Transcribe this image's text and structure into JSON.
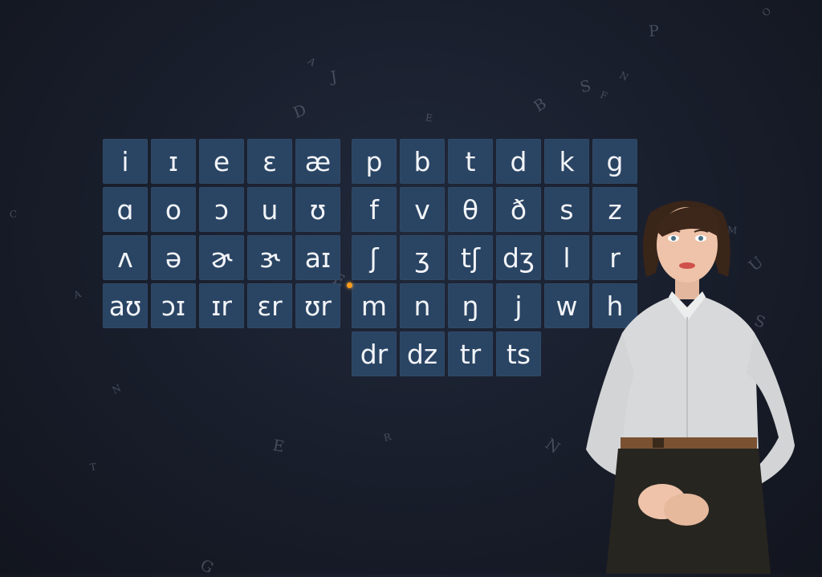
{
  "background_letters": [
    "O",
    "P",
    "A",
    "J",
    "N",
    "S",
    "F",
    "D",
    "T",
    "G",
    "E",
    "B",
    "M",
    "U",
    "C",
    "N",
    "T",
    "G",
    "R",
    "E",
    "A",
    "S",
    "N",
    "E"
  ],
  "vowel_keys": [
    "i",
    "ɪ",
    "e",
    "ɛ",
    "æ",
    "ɑ",
    "o",
    "ɔ",
    "u",
    "ʊ",
    "ʌ",
    "ə",
    "ɚ",
    "ɝ",
    "aɪ",
    "aʊ",
    "ɔɪ",
    "ɪr",
    "ɛr",
    "ʊr"
  ],
  "consonant_keys": [
    "p",
    "b",
    "t",
    "d",
    "k",
    "g",
    "f",
    "v",
    "θ",
    "ð",
    "s",
    "z",
    "ʃ",
    "ʒ",
    "tʃ",
    "dʒ",
    "l",
    "r",
    "m",
    "n",
    "ŋ",
    "j",
    "w",
    "h",
    "dr",
    "dz",
    "tr",
    "ts"
  ],
  "colors": {
    "key_bg": "#2a4463",
    "key_text": "#f2f4f8",
    "background": "#181d2a",
    "cursor": "#ff9d1a"
  }
}
